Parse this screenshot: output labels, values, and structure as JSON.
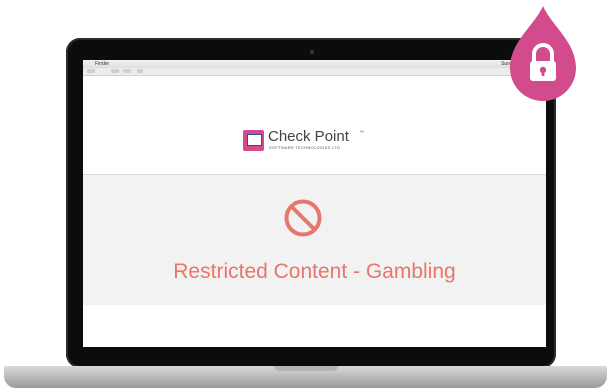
{
  "screen": {
    "menubar": {
      "apple_glyph": "",
      "app_name": "Finder",
      "right_text": "Sun"
    },
    "brand": {
      "name": "Check Point",
      "trademark": "™",
      "subtitle": "SOFTWARE TECHNOLOGIES LTD."
    },
    "block": {
      "icon": "prohibited-icon",
      "message": "Restricted Content - Gambling",
      "color": "#e8766a"
    }
  },
  "badge": {
    "icon": "lock-icon",
    "color": "#d24b8c"
  }
}
